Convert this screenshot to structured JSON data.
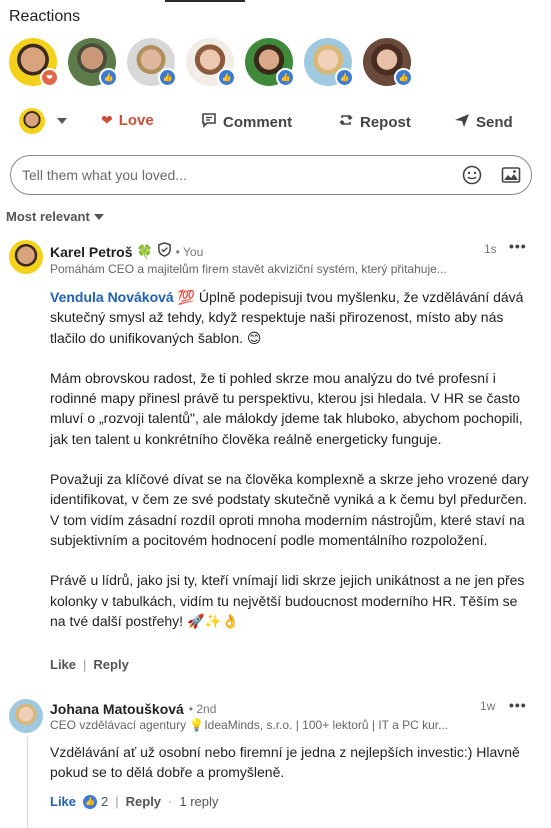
{
  "reactions": {
    "title": "Reactions",
    "avatars": [
      {
        "name": "reactor-1",
        "badge": "love"
      },
      {
        "name": "reactor-2",
        "badge": "like"
      },
      {
        "name": "reactor-3",
        "badge": "like"
      },
      {
        "name": "reactor-4",
        "badge": "like"
      },
      {
        "name": "reactor-5",
        "badge": "like"
      },
      {
        "name": "reactor-6",
        "badge": "like"
      },
      {
        "name": "reactor-7",
        "badge": "like"
      }
    ]
  },
  "actions": {
    "love": "Love",
    "comment": "Comment",
    "repost": "Repost",
    "send": "Send"
  },
  "comment_box": {
    "placeholder": "Tell them what you loved..."
  },
  "sort": {
    "label": "Most relevant"
  },
  "comments": [
    {
      "author": "Karel Petroš",
      "author_emoji": "🍀",
      "tag": "• You",
      "time": "1s",
      "headline": "Pomáhám CEO a majitelům firem stavět akviziční systém, který přitahuje...",
      "mention": "Vendula Nováková",
      "mention_emoji": "💯",
      "p1_rest": " Úplně podepisuji tvou myšlenku, že vzdělávání dává skutečný smysl až tehdy, když respektuje naši přirozenost, místo aby nás tlačilo do unifikovaných šablon. 😊",
      "p2": "Mám obrovskou radost, že ti pohled skrze mou analýzu do tvé profesní i rodinné mapy přinesl právě tu perspektivu, kterou jsi hledala. V HR se často mluví o „rozvoji talentů\", ale málokdy jdeme tak hluboko, abychom pochopili, jak ten talent u konkrétního člověka reálně energeticky funguje.",
      "p3": "Považuji za klíčové dívat se na člověka komplexně a skrze jeho vrozené dary identifikovat, v čem ze své podstaty skutečně vyniká a k čemu byl předurčen. V tom vidím zásadní rozdíl oproti mnoha moderním nástrojům, které staví na subjektivním a pocitovém hodnocení podle momentálního rozpoložení.",
      "p4": "Právě u lídrů, jako jsi ty, kteří vnímají lidi skrze jejich unikátnost a ne jen přes kolonky v tabulkách, vidím tu největší budoucnost moderního HR. Těším se na tvé další postřehy! 🚀✨👌",
      "like": "Like",
      "reply": "Reply"
    },
    {
      "author": "Johana Matoušková",
      "tag": "• 2nd",
      "time": "1w",
      "headline": "CEO vzdělávací agentury 💡IdeaMinds, s.r.o. | 100+ lektorů | IT a PC kur...",
      "body": "Vzdělávání ať už osobní nebo firemní je jedna z nejlepších investic:) Hlavně pokud se to dělá dobře a promyšleně.",
      "like": "Like",
      "like_count": "2",
      "reply": "Reply",
      "replies": "1 reply"
    }
  ]
}
